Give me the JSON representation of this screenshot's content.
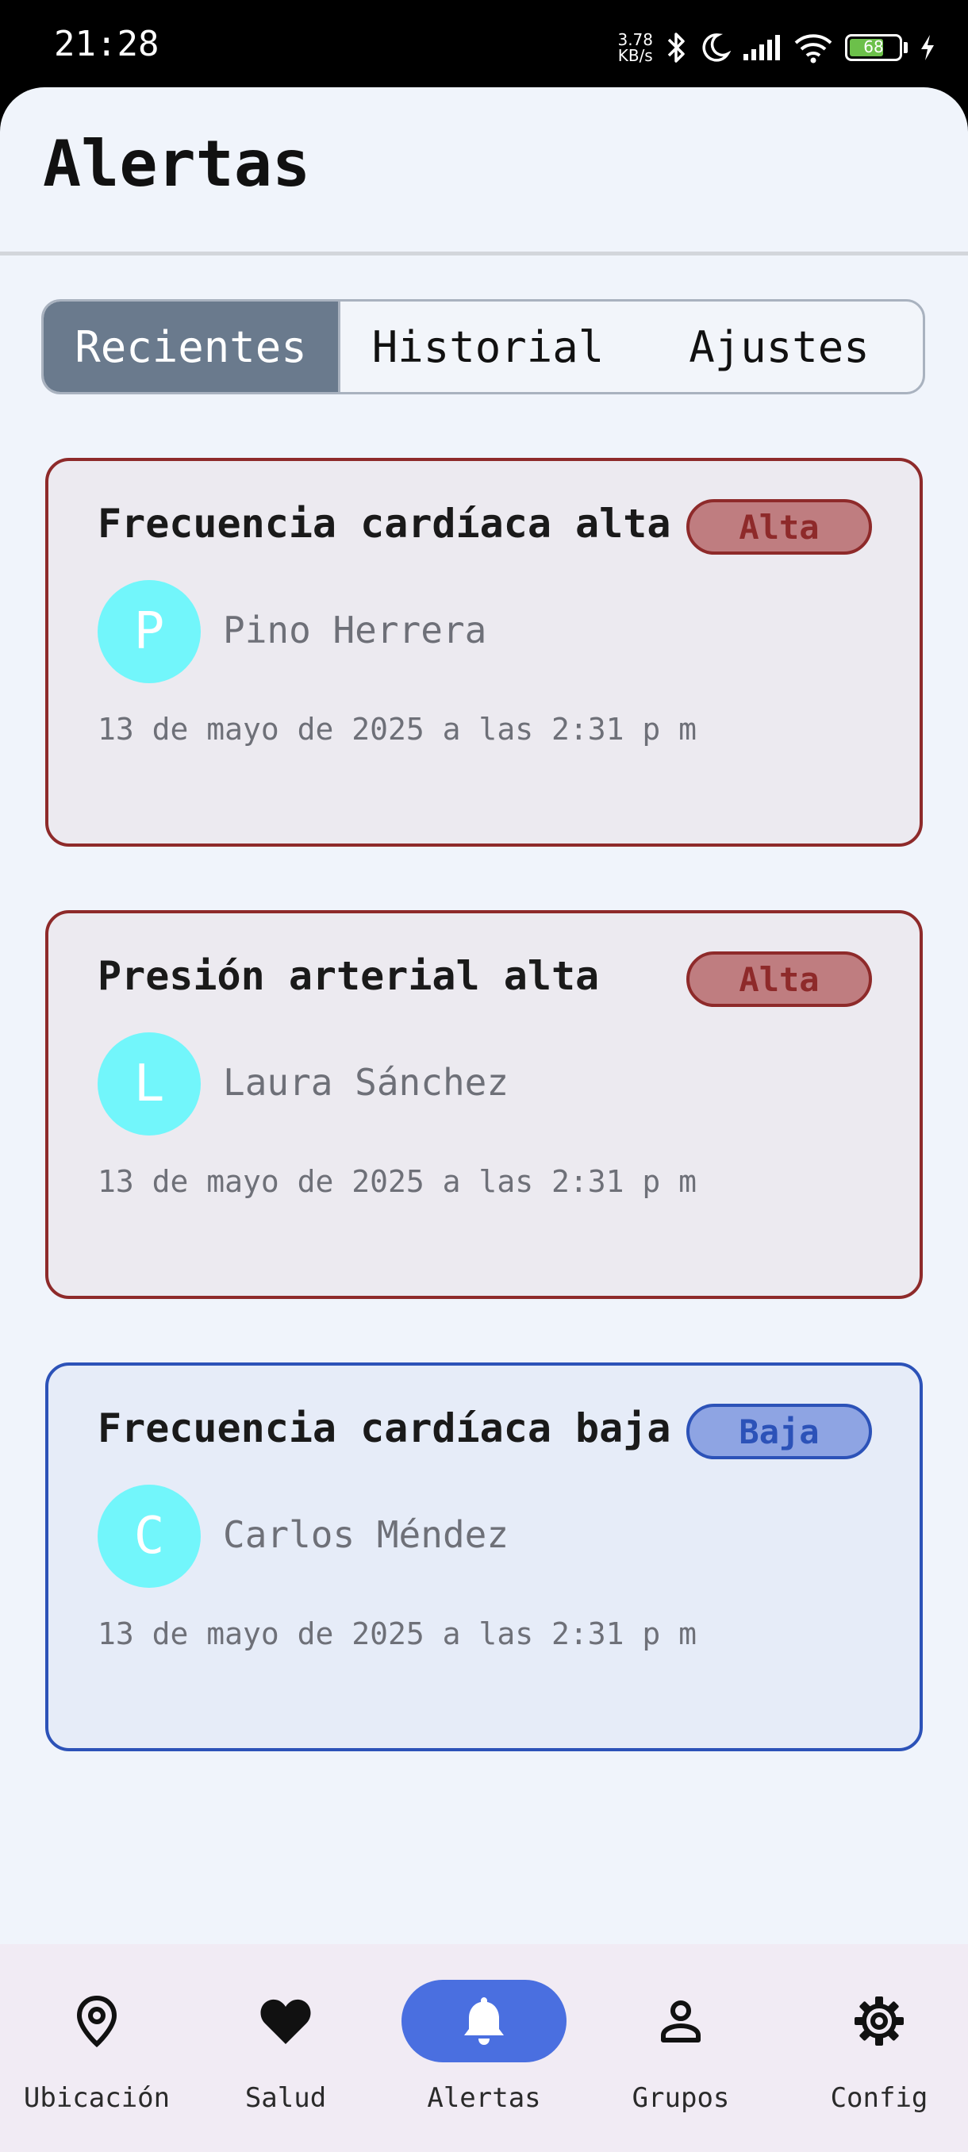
{
  "status_bar": {
    "time": "21:28",
    "net_speed_value": "3.78",
    "net_speed_unit": "KB/s",
    "battery": "68"
  },
  "page": {
    "title": "Alertas"
  },
  "tabs": [
    {
      "label": "Recientes",
      "active": true
    },
    {
      "label": "Historial",
      "active": false
    },
    {
      "label": "Ajustes",
      "active": false
    }
  ],
  "alerts": [
    {
      "title": "Frecuencia cardíaca alta",
      "severity": "Alta",
      "initial": "P",
      "person": "Pino Herrera",
      "timestamp": "13 de mayo de 2025 a las 2:31 p m"
    },
    {
      "title": "Presión arterial alta",
      "severity": "Alta",
      "initial": "L",
      "person": "Laura Sánchez",
      "timestamp": "13 de mayo de 2025 a las 2:31 p m"
    },
    {
      "title": "Frecuencia cardíaca baja",
      "severity": "Baja",
      "initial": "C",
      "person": "Carlos Méndez",
      "timestamp": "13 de mayo de 2025 a las 2:31 p m"
    }
  ],
  "nav": [
    {
      "label": "Ubicación",
      "icon": "location-pin-icon"
    },
    {
      "label": "Salud",
      "icon": "heart-icon"
    },
    {
      "label": "Alertas",
      "icon": "bell-icon",
      "active": true
    },
    {
      "label": "Grupos",
      "icon": "person-icon"
    },
    {
      "label": "Config",
      "icon": "gear-icon"
    }
  ],
  "colors": {
    "high_border": "#8e2a2a",
    "high_badge": "#bf7d80",
    "low_border": "#2c52b8",
    "low_badge": "#8ea4e3",
    "avatar": "#72f6fb",
    "active_nav": "#4a6fe0",
    "active_tab": "#6a7a8d"
  }
}
